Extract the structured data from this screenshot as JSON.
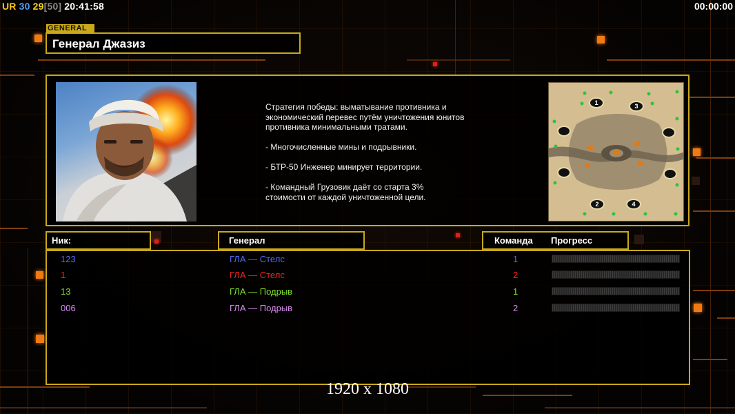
{
  "hud": {
    "ur_label": "UR",
    "num_a": "30",
    "num_b": "29",
    "num_c": "[50]",
    "clock": "20:41:58",
    "timer": "00:00:00"
  },
  "general": {
    "tag": "GENERAL",
    "name": "Генерал Джазиз",
    "portrait_icon": "general-portrait",
    "strategy": [
      "Стратегия победы: выматывание противника и\n экономический перевес путём уничтожения юнитов\n противника минимальными тратами.",
      "- Многочисленные мины и подрывники.",
      "- БТР-50 Инженер минирует территории.",
      "- Командный Грузовик даёт со старта 3%\n стоимости от каждой уничтоженной цели."
    ],
    "map_icon": "minimap-desert",
    "map_spawns": [
      "1",
      "3",
      "2",
      "4"
    ]
  },
  "table": {
    "col_nick": "Ник:",
    "col_general": "Генерал",
    "col_team": "Команда",
    "col_progress": "Прогресс"
  },
  "players": [
    {
      "nick": "123",
      "general": "ГЛА — Стелс",
      "team": "1",
      "color": "#4f6cf5",
      "progress": 0
    },
    {
      "nick": "1",
      "general": "ГЛА — Стелс",
      "team": "2",
      "color": "#f0241a",
      "progress": 0
    },
    {
      "nick": "13",
      "general": "ГЛА — Подрыв",
      "team": "1",
      "color": "#7ee02e",
      "progress": 0
    },
    {
      "nick": "006",
      "general": "ГЛА — Подрыв",
      "team": "2",
      "color": "#d88cf0",
      "progress": 0
    }
  ],
  "caption": "1920 x 1080",
  "colors": {
    "frame": "#c9a919",
    "accent_orange": "#f07a14",
    "hud_ur": "#f5c61a",
    "hud_blue": "#4f9df5",
    "hud_yellow": "#f5d21a",
    "hud_grey": "#8a8a8a"
  }
}
